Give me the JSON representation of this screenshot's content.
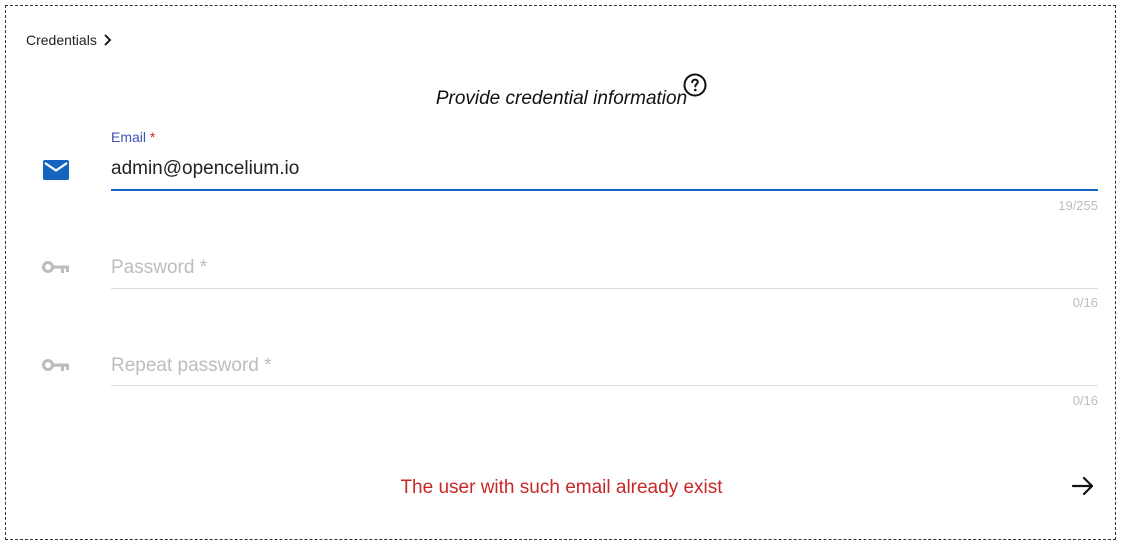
{
  "breadcrumb": {
    "label": "Credentials"
  },
  "form": {
    "title": "Provide credential information",
    "email": {
      "label": "Email",
      "required_mark": "*",
      "value": "admin@opencelium.io",
      "counter": "19/255"
    },
    "password": {
      "placeholder": "Password *",
      "value": "",
      "counter": "0/16"
    },
    "repeat_password": {
      "placeholder": "Repeat password *",
      "value": "",
      "counter": "0/16"
    },
    "error_message": "The user with such email already exist"
  },
  "colors": {
    "accent": "#1565c0",
    "label": "#3f51b5",
    "required": "#d32f2f",
    "error": "#c62828",
    "disabled": "#bdbdbd"
  },
  "icons": {
    "breadcrumb": "chevron-right-icon",
    "help": "question-circle-icon",
    "email": "envelope-icon",
    "password": "key-icon",
    "repeat_password": "key-icon",
    "next": "arrow-right-icon"
  }
}
